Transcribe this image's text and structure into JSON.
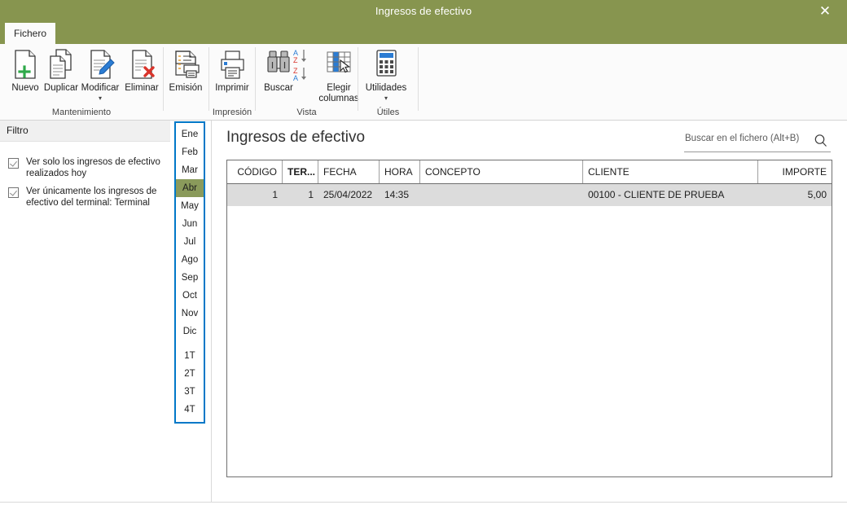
{
  "window": {
    "title": "Ingresos de efectivo",
    "close_label": "✕"
  },
  "tabs": [
    {
      "label": "Fichero",
      "active": true
    }
  ],
  "ribbon": {
    "groups": [
      {
        "name": "Mantenimiento",
        "label": "Mantenimiento",
        "buttons": [
          {
            "label": "Nuevo",
            "icon": "new-document-icon",
            "caret": ""
          },
          {
            "label": "Duplicar",
            "icon": "duplicate-document-icon",
            "caret": ""
          },
          {
            "label": "Modificar",
            "icon": "edit-document-icon",
            "caret": "▾"
          },
          {
            "label": "Eliminar",
            "icon": "delete-document-icon",
            "caret": ""
          }
        ]
      },
      {
        "name": "Emision",
        "label": "",
        "buttons": [
          {
            "label": "Emisión",
            "icon": "report-print-icon",
            "caret": ""
          }
        ]
      },
      {
        "name": "Impresion",
        "label": "Impresión",
        "buttons": [
          {
            "label": "Imprimir",
            "icon": "printer-icon",
            "caret": ""
          }
        ]
      },
      {
        "name": "Vista",
        "label": "Vista",
        "buttons": [
          {
            "label": "Buscar",
            "icon": "binoculars-icon",
            "caret": ""
          },
          {
            "label": "",
            "icon": "sort-az-za-icon",
            "caret": ""
          },
          {
            "label": "Elegir columnas",
            "icon": "choose-columns-icon",
            "caret": ""
          }
        ]
      },
      {
        "name": "Utiles",
        "label": "Útiles",
        "buttons": [
          {
            "label": "Utilidades",
            "icon": "calculator-icon",
            "caret": "▾"
          }
        ]
      }
    ]
  },
  "filter": {
    "header": "Filtro",
    "options": [
      {
        "label": "Ver solo los ingresos de efectivo realizados hoy",
        "checked": true
      },
      {
        "label": "Ver únicamente los ingresos de efectivo del terminal: Terminal",
        "checked": true
      }
    ]
  },
  "period_selector": {
    "months": [
      "Ene",
      "Feb",
      "Mar",
      "Abr",
      "May",
      "Jun",
      "Jul",
      "Ago",
      "Sep",
      "Oct",
      "Nov",
      "Dic"
    ],
    "quarters": [
      "1T",
      "2T",
      "3T",
      "4T"
    ],
    "selected": "Abr"
  },
  "main": {
    "title": "Ingresos de efectivo",
    "search": {
      "placeholder": "Buscar en el fichero (Alt+B)",
      "value": "",
      "icon": "search-icon"
    },
    "table": {
      "columns": [
        {
          "key": "codigo",
          "label": "CÓDIGO",
          "align": "right",
          "bold": false
        },
        {
          "key": "ter",
          "label": "TER...",
          "align": "right",
          "bold": true
        },
        {
          "key": "fecha",
          "label": "FECHA",
          "align": "left",
          "bold": false
        },
        {
          "key": "hora",
          "label": "HORA",
          "align": "left",
          "bold": false
        },
        {
          "key": "concepto",
          "label": "CONCEPTO",
          "align": "left",
          "bold": false
        },
        {
          "key": "cliente",
          "label": "CLIENTE",
          "align": "left",
          "bold": false
        },
        {
          "key": "importe",
          "label": "IMPORTE",
          "align": "right",
          "bold": false
        }
      ],
      "rows": [
        {
          "codigo": "1",
          "ter": "1",
          "fecha": "25/04/2022",
          "hora": "14:35",
          "concepto": "",
          "cliente": "00100 - CLIENTE DE PRUEBA",
          "importe": "5,00",
          "selected": true
        }
      ]
    }
  },
  "colors": {
    "title_bar": "#87954f",
    "selection_green": "#8a9a5b",
    "focus_blue": "#0078c8",
    "row_selected": "#dcdcdc"
  }
}
